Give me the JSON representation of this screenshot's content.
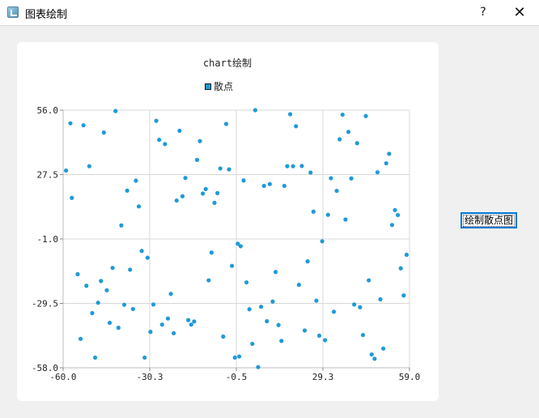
{
  "window": {
    "title": "图表绘制",
    "help_label": "?",
    "close_label": "✕",
    "icon": "chart-app-icon"
  },
  "controls": {
    "draw_button_label": "绘制散点图"
  },
  "colors": {
    "point": "#1f9ad6",
    "grid": "#d8d8d8",
    "axis": "#bcbcbc"
  },
  "chart_data": {
    "type": "scatter",
    "title": "chart绘制",
    "legend": "top",
    "xlim": [
      -60.0,
      59.0
    ],
    "ylim": [
      -58.0,
      56.0
    ],
    "xticks": [
      "-60.0",
      "-30.3",
      "-0.5",
      "29.3",
      "59.0"
    ],
    "yticks": [
      "56.0",
      "27.5",
      "-1.0",
      "-29.5",
      "-58.0"
    ],
    "grid": true,
    "series": [
      {
        "name": "散点",
        "points": [
          [
            -59,
            29.3
          ],
          [
            -57.5,
            50.2
          ],
          [
            -57,
            17.2
          ],
          [
            -55,
            -16.6
          ],
          [
            -54,
            -45.2
          ],
          [
            -53,
            49.3
          ],
          [
            -52,
            -21.7
          ],
          [
            -51,
            31.2
          ],
          [
            -50,
            -33.8
          ],
          [
            -49,
            -53.5
          ],
          [
            -48,
            -29.2
          ],
          [
            -47,
            -19.6
          ],
          [
            -46,
            46.1
          ],
          [
            -45,
            -23.7
          ],
          [
            -44,
            -38.1
          ],
          [
            -43,
            -13.8
          ],
          [
            -42,
            55.6
          ],
          [
            -41,
            -40.3
          ],
          [
            -40,
            5.0
          ],
          [
            -39,
            -30.1
          ],
          [
            -38,
            20.4
          ],
          [
            -37,
            -14.6
          ],
          [
            -36,
            -32.0
          ],
          [
            -35,
            24.8
          ],
          [
            -34,
            13.4
          ],
          [
            -33,
            -6.3
          ],
          [
            -32,
            -53.5
          ],
          [
            -31,
            -9.3
          ],
          [
            -30,
            -42.1
          ],
          [
            -29,
            -30.0
          ],
          [
            -28,
            51.3
          ],
          [
            -27,
            42.9
          ],
          [
            -26,
            -38.9
          ],
          [
            -25,
            41.0
          ],
          [
            -24,
            -36.2
          ],
          [
            -23,
            -25.3
          ],
          [
            -22,
            -42.7
          ],
          [
            -21,
            16.0
          ],
          [
            -20,
            46.9
          ],
          [
            -19,
            17.9
          ],
          [
            -18,
            26.0
          ],
          [
            -17,
            -36.9
          ],
          [
            -16,
            -38.9
          ],
          [
            -15,
            -37.5
          ],
          [
            -14,
            34.0
          ],
          [
            -13,
            42.3
          ],
          [
            -12,
            19.1
          ],
          [
            -11,
            21.1
          ],
          [
            -10,
            -19.3
          ],
          [
            -9,
            -7.0
          ],
          [
            -8,
            15.0
          ],
          [
            -7,
            19.3
          ],
          [
            -6,
            30.2
          ],
          [
            -5,
            -44.2
          ],
          [
            -4,
            49.9
          ],
          [
            -3,
            29.8
          ],
          [
            -2,
            -12.9
          ],
          [
            -1,
            -53.5
          ],
          [
            0,
            -3.1
          ],
          [
            0.5,
            -53.0
          ],
          [
            1,
            -4.2
          ],
          [
            2,
            24.9
          ],
          [
            3,
            -20.2
          ],
          [
            4,
            -32.1
          ],
          [
            5,
            -47.4
          ],
          [
            6,
            56.0
          ],
          [
            7,
            -57.7
          ],
          [
            8,
            -31.0
          ],
          [
            9,
            22.5
          ],
          [
            10,
            -37.4
          ],
          [
            11,
            23.3
          ],
          [
            12,
            -28.7
          ],
          [
            13,
            -15.6
          ],
          [
            14,
            -39.1
          ],
          [
            15,
            -46.1
          ],
          [
            16,
            22.5
          ],
          [
            17,
            31.2
          ],
          [
            18,
            54.2
          ],
          [
            19,
            31.2
          ],
          [
            20,
            48.9
          ],
          [
            21,
            -21.3
          ],
          [
            22,
            31.3
          ],
          [
            23,
            -41.5
          ],
          [
            24,
            -10.9
          ],
          [
            25,
            28.4
          ],
          [
            26,
            11.1
          ],
          [
            27,
            -28.3
          ],
          [
            28,
            -43.8
          ],
          [
            29,
            -2.0
          ],
          [
            30,
            -45.8
          ],
          [
            31,
            9.7
          ],
          [
            32,
            25.9
          ],
          [
            33,
            -33.2
          ],
          [
            34,
            20.3
          ],
          [
            35,
            43.1
          ],
          [
            36,
            54.0
          ],
          [
            37,
            7.6
          ],
          [
            38,
            46.4
          ],
          [
            39,
            25.8
          ],
          [
            40,
            -30.0
          ],
          [
            41,
            41.4
          ],
          [
            42,
            -31.2
          ],
          [
            43,
            -43.5
          ],
          [
            44,
            53.4
          ],
          [
            45,
            -19.3
          ],
          [
            46,
            -52.1
          ],
          [
            47,
            -54.0
          ],
          [
            48,
            28.5
          ],
          [
            49,
            -27.7
          ],
          [
            50,
            -49.5
          ],
          [
            51,
            32.5
          ],
          [
            52,
            36.7
          ],
          [
            53,
            5.2
          ],
          [
            54,
            11.8
          ],
          [
            55,
            9.6
          ],
          [
            56,
            -14.0
          ],
          [
            57,
            -26.0
          ],
          [
            58,
            -8.0
          ]
        ]
      }
    ]
  }
}
